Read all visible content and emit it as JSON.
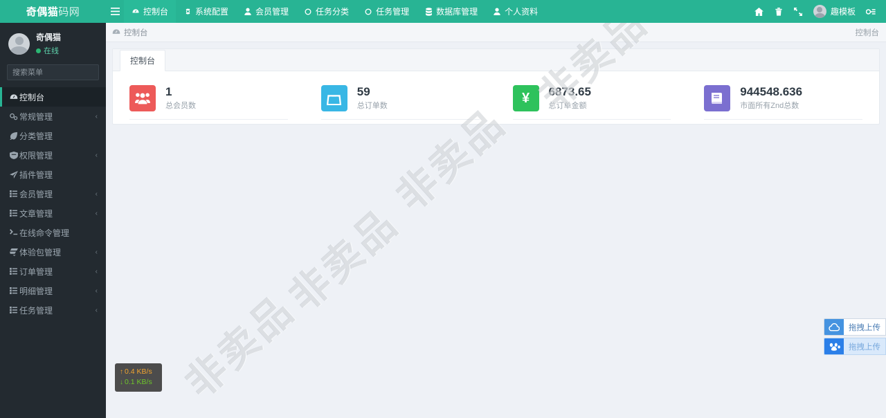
{
  "brand": {
    "bold": "奇偶猫",
    "light": "码网"
  },
  "topnav": {
    "toggle_icon": "hamburger-icon",
    "items": [
      {
        "label": "控制台",
        "icon": "dashboard-icon",
        "active": true
      },
      {
        "label": "系统配置",
        "icon": "gear-icon",
        "active": false
      },
      {
        "label": "会员管理",
        "icon": "user-icon",
        "active": false
      },
      {
        "label": "任务分类",
        "icon": "circle-icon",
        "active": false
      },
      {
        "label": "任务管理",
        "icon": "circle-icon",
        "active": false
      },
      {
        "label": "数据库管理",
        "icon": "database-icon",
        "active": false
      },
      {
        "label": "个人资料",
        "icon": "user-icon",
        "active": false
      }
    ],
    "right": {
      "home_icon": "home-icon",
      "trash_icon": "trash-icon",
      "fullscreen_icon": "fullscreen-icon",
      "user_label": "趣模板",
      "avatar_icon": "avatar-icon",
      "settings_icon": "gear-cog-icon"
    }
  },
  "sidebar": {
    "profile": {
      "name": "奇偶猫",
      "status": "在线"
    },
    "search": {
      "placeholder": "搜索菜单",
      "value": "",
      "icon": "search-icon"
    },
    "items": [
      {
        "label": "控制台",
        "icon": "dashboard-icon",
        "active": true,
        "caret": ""
      },
      {
        "label": "常规管理",
        "icon": "cogs-icon",
        "active": false,
        "caret": "‹"
      },
      {
        "label": "分类管理",
        "icon": "leaf-icon",
        "active": false,
        "caret": ""
      },
      {
        "label": "权限管理",
        "icon": "shield-icon",
        "active": false,
        "caret": "‹"
      },
      {
        "label": "插件管理",
        "icon": "plug-icon",
        "active": false,
        "caret": ""
      },
      {
        "label": "会员管理",
        "icon": "list-icon",
        "active": false,
        "caret": "‹"
      },
      {
        "label": "文章管理",
        "icon": "list-icon",
        "active": false,
        "caret": "‹"
      },
      {
        "label": "在线命令管理",
        "icon": "terminal-icon",
        "active": false,
        "caret": ""
      },
      {
        "label": "体验包管理",
        "icon": "ticket-icon",
        "active": false,
        "caret": "‹"
      },
      {
        "label": "订单管理",
        "icon": "list-icon",
        "active": false,
        "caret": "‹"
      },
      {
        "label": "明细管理",
        "icon": "list-icon",
        "active": false,
        "caret": "‹"
      },
      {
        "label": "任务管理",
        "icon": "list-icon",
        "active": false,
        "caret": "‹"
      }
    ]
  },
  "breadcrumb": {
    "icon": "dashboard-icon",
    "text": "控制台",
    "right_text": "控制台"
  },
  "tabs": [
    {
      "label": "控制台",
      "active": true
    }
  ],
  "cards": [
    {
      "value": "1",
      "label": "总会员数",
      "icon": "users-icon",
      "color": "#ed5a59"
    },
    {
      "value": "59",
      "label": "总订单数",
      "icon": "bag-icon",
      "color": "#39b7e5"
    },
    {
      "value": "6873.65",
      "label": "总订单金额",
      "icon": "yen-icon",
      "color": "#2ec25c"
    },
    {
      "value": "944548.636",
      "label": "市面所有Znd总数",
      "icon": "book-icon",
      "color": "#7b6fd0"
    }
  ],
  "netspeed": {
    "up": "0.4 KB/s",
    "down": "0.1 KB/s",
    "up_icon": "arrow-up-icon",
    "down_icon": "arrow-down-icon",
    "up_color": "#f0a430",
    "down_color": "#6fc52b"
  },
  "uploads": [
    {
      "label": "拖拽上传",
      "icon": "cloud-upload-icon"
    },
    {
      "label": "拖拽上传",
      "icon": "baidu-cloud-icon"
    }
  ],
  "watermark": {
    "text": "非卖品",
    "count": 4
  }
}
